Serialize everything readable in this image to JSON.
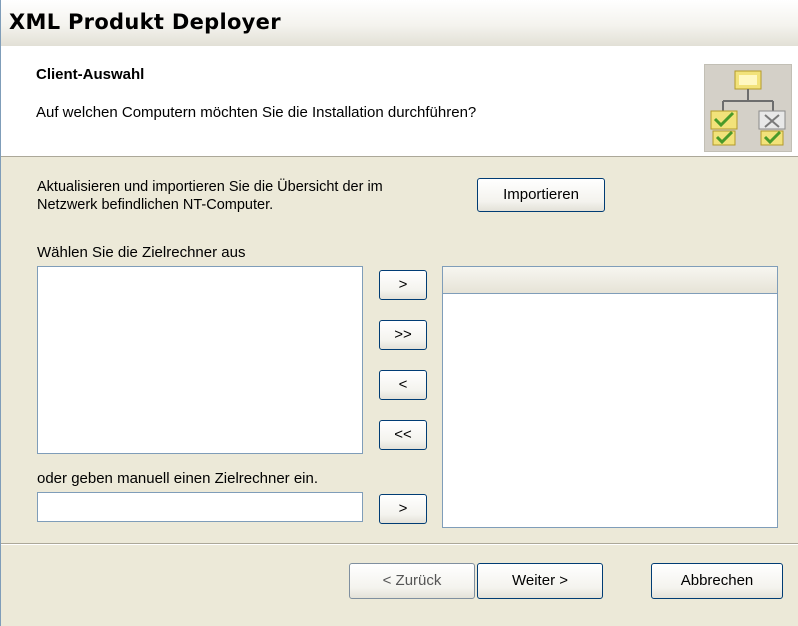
{
  "window": {
    "title": "XML Produkt Deployer"
  },
  "header": {
    "title": "Client-Auswahl",
    "subtitle": "Auf welchen Computern möchten Sie die Installation durchführen?",
    "icon": "network-computers-icon"
  },
  "import_section": {
    "text_line1": "Aktualisieren und importieren Sie die Übersicht der im",
    "text_line2": "Netzwerk befindlichen NT-Computer.",
    "button": "Importieren"
  },
  "selection": {
    "label": "Wählen Sie die Zielrechner aus",
    "available_items": [],
    "selected_items": [],
    "buttons": {
      "add_one": ">",
      "add_all": ">>",
      "remove_one": "<",
      "remove_all": "<<"
    }
  },
  "manual_entry": {
    "label": "oder geben manuell einen Zielrechner ein.",
    "value": "",
    "add_button": ">"
  },
  "footer": {
    "back": "< Zurück",
    "next": "Weiter >",
    "cancel": "Abbrechen"
  }
}
